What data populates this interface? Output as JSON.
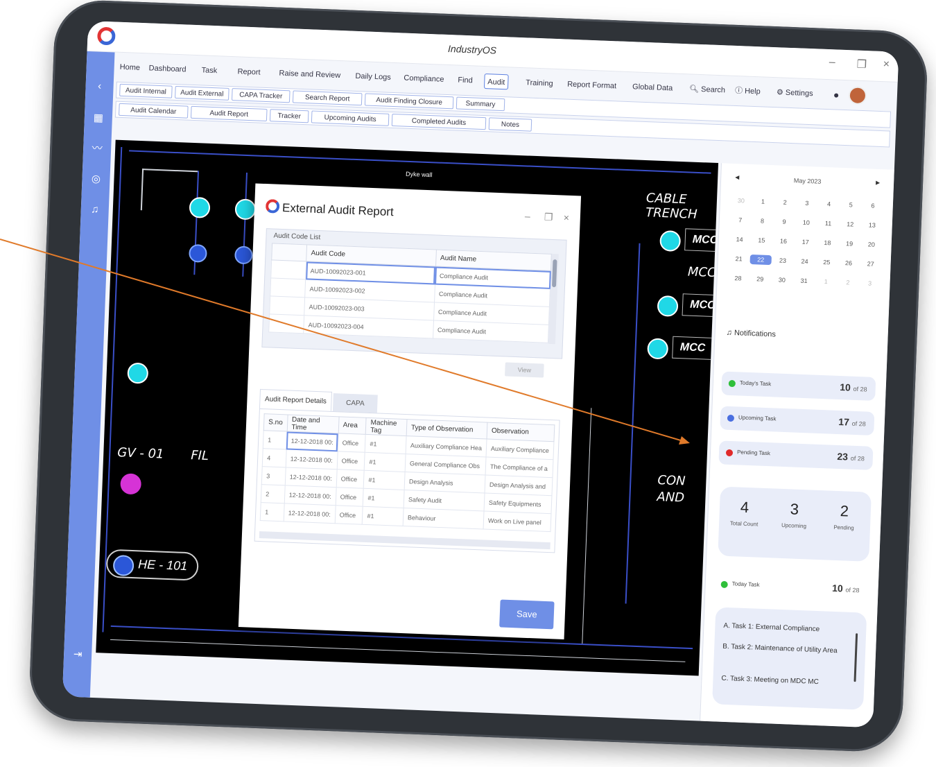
{
  "app": {
    "title": "IndustryOS",
    "minimize": "–",
    "restore": "❐",
    "close": "×"
  },
  "menu": {
    "items": [
      "Home",
      "Dashboard",
      "Task",
      "Report",
      "Raise and Review",
      "Daily Logs",
      "Compliance",
      "Find",
      "Audit",
      "Training",
      "Report Format",
      "Global Data"
    ],
    "active": "Audit",
    "search": "Search",
    "help": "Help",
    "settings": "Settings"
  },
  "tabs_row1": [
    "Audit Internal",
    "Audit External",
    "CAPA Tracker",
    "Search Report",
    "Audit Finding Closure",
    "Summary"
  ],
  "tabs_row2": [
    "Audit Calendar",
    "Audit Report",
    "Tracker",
    "Upcoming Audits",
    "Completed Audits",
    "Notes"
  ],
  "schematic": {
    "labels": {
      "cable_trench": "CABLE TRENCH",
      "gv": "GV - 01",
      "fil": "FIL",
      "he": "HE - 101",
      "con": "CON",
      "and": "AND",
      "mcc": "MCC",
      "dyke": "Dyke wall"
    }
  },
  "modal": {
    "title": "External Audit Report",
    "code_list_label": "Audit Code List",
    "code_headers": [
      "Audit Code",
      "Audit Name"
    ],
    "code_rows": [
      [
        "AUD-10092023-001",
        "Compliance Audit"
      ],
      [
        "AUD-10092023-002",
        "Compliance Audit"
      ],
      [
        "AUD-10092023-003",
        "Compliance Audit"
      ],
      [
        "AUD-10092023-004",
        "Compliance Audit"
      ]
    ],
    "view_btn": "View",
    "detail_tabs": [
      "Audit Report Details",
      "CAPA"
    ],
    "detail_headers": [
      "S.no",
      "Date and Time",
      "Area",
      "Machine Tag",
      "Type of Observation",
      "Observation"
    ],
    "detail_rows": [
      [
        "1",
        "12-12-2018 00:",
        "Office",
        "#1",
        "Auxiliary Compliance Hea",
        "Auxiliary Compliance"
      ],
      [
        "4",
        "12-12-2018 00:",
        "Office",
        "#1",
        "General Compliance Obs",
        "The Compliance of a"
      ],
      [
        "3",
        "12-12-2018 00:",
        "Office",
        "#1",
        "Design Analysis",
        "Design Analysis and"
      ],
      [
        "2",
        "12-12-2018 00:",
        "Office",
        "#1",
        "Safety Audit",
        "Safety Equipments"
      ],
      [
        "1",
        "12-12-2018 00:",
        "Office",
        "#1",
        "Behaviour",
        "Work on Live panel"
      ]
    ],
    "save": "Save"
  },
  "calendar": {
    "month": "May 2023",
    "days": [
      "30",
      "1",
      "2",
      "3",
      "4",
      "5",
      "6",
      "7",
      "8",
      "9",
      "10",
      "11",
      "12",
      "13",
      "14",
      "15",
      "16",
      "17",
      "18",
      "19",
      "20",
      "21",
      "22",
      "23",
      "24",
      "25",
      "26",
      "27",
      "28",
      "29",
      "30",
      "31",
      "1",
      "2",
      "3"
    ],
    "today": "22"
  },
  "notifications": {
    "title": "Notifications",
    "cards": [
      {
        "label": "Today's Task",
        "count": "10",
        "total": "of 28",
        "color": "#2fbf3a"
      },
      {
        "label": "Upcoming Task",
        "count": "17",
        "total": "of 28",
        "color": "#4a6fe0"
      },
      {
        "label": "Pending Task",
        "count": "23",
        "total": "of 28",
        "color": "#e02a2a"
      }
    ],
    "stats": [
      {
        "num": "4",
        "label": "Total Count"
      },
      {
        "num": "3",
        "label": "Upcoming"
      },
      {
        "num": "2",
        "label": "Pending"
      }
    ],
    "today_card": {
      "label": "Today Task",
      "count": "10",
      "total": "of 28"
    },
    "list": [
      "A. Task 1: External Compliance",
      "B. Task 2: Maintenance of Utility Area",
      "C. Task 3: Meeting on MDC MC"
    ]
  },
  "colors": {
    "accent": "#6f8fe6",
    "arrow": "#e07a2a"
  }
}
